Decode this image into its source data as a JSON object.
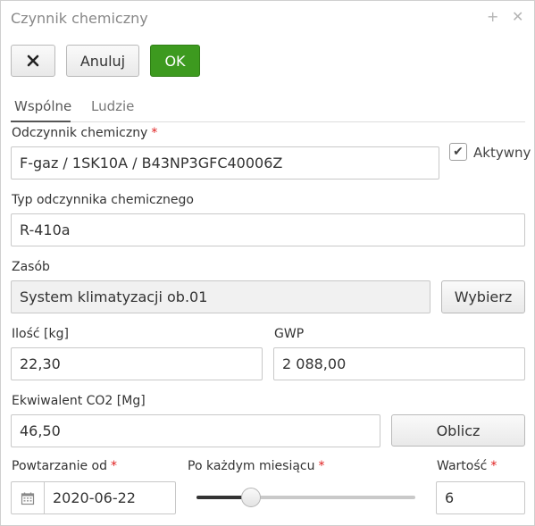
{
  "dialog": {
    "title": "Czynnik chemiczny",
    "plus_glyph": "+",
    "close_glyph": "✕"
  },
  "toolbar": {
    "close_glyph": "✕",
    "cancel_label": "Anuluj",
    "ok_label": "OK",
    "ok_color": "#3d9a1f"
  },
  "tabs": [
    {
      "label": "Wspólne",
      "active": true
    },
    {
      "label": "Ludzie",
      "active": false
    }
  ],
  "form": {
    "agent": {
      "label": "Odczynnik chemiczny",
      "required": "*",
      "value": "F-gaz / 1SK10A / B43NP3GFC40006Z"
    },
    "active": {
      "label": "Aktywny",
      "checked": true,
      "glyph": "✔"
    },
    "agent_type": {
      "label": "Typ odczynnika chemicznego",
      "value": "R-410a"
    },
    "resource": {
      "label": "Zasób",
      "value": "System klimatyzacji ob.01",
      "button": "Wybierz"
    },
    "quantity": {
      "label": "Ilość [kg]",
      "value": "22,30"
    },
    "gwp": {
      "label": "GWP",
      "value": "2 088,00"
    },
    "co2": {
      "label": "Ekwiwalent CO2 [Mg]",
      "value": "46,50",
      "button": "Oblicz"
    },
    "repeat_from": {
      "label": "Powtarzanie od",
      "required": "*",
      "value": "2020-06-22",
      "icon": "calendar-icon"
    },
    "every_month": {
      "label": "Po każdym miesiącu",
      "required": "*",
      "slider_level": 0.25
    },
    "value": {
      "label": "Wartość",
      "required": "*",
      "value": "6"
    }
  },
  "colors": {
    "required": "#e02020",
    "tab_active": "#555555"
  }
}
